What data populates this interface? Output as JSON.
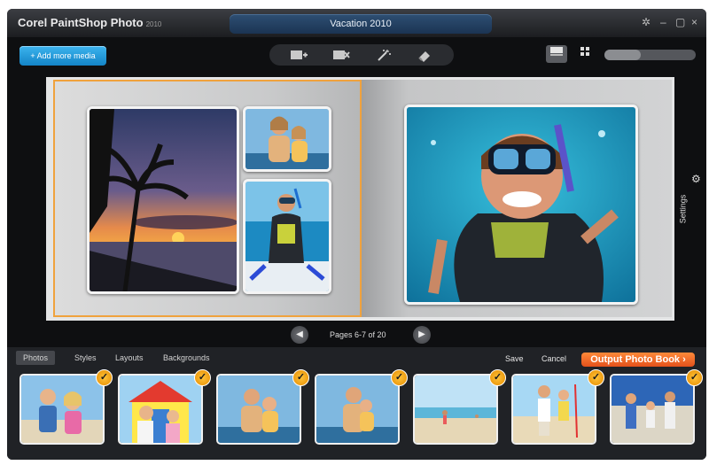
{
  "app": {
    "title": "Corel PaintShop Photo",
    "version": "2010",
    "document_title": "Vacation 2010"
  },
  "toolbar": {
    "add_media_label": "+ Add more media",
    "tools": [
      {
        "icon": "add-photo-icon"
      },
      {
        "icon": "remove-photo-icon"
      },
      {
        "icon": "magic-wand-icon"
      },
      {
        "icon": "eraser-icon"
      }
    ],
    "views": [
      {
        "icon": "single-view-icon",
        "active": true
      },
      {
        "icon": "grid-view-icon",
        "active": false
      }
    ],
    "zoom": 0.4
  },
  "window_controls": {
    "settings_symbol": "✲",
    "minimize_symbol": "–",
    "maximize_symbol": "▢",
    "close_symbol": "×"
  },
  "book": {
    "page_indicator": "Pages 6-7 of 20",
    "photos": [
      "palm-trees-sunset",
      "mother-daughter-beach",
      "woman-snorkel-boat",
      "woman-diver-closeup"
    ]
  },
  "settings_label": "Settings",
  "bottom": {
    "tabs": [
      {
        "label": "Photos",
        "active": true
      },
      {
        "label": "Styles",
        "active": false
      },
      {
        "label": "Layouts",
        "active": false
      },
      {
        "label": "Backgrounds",
        "active": false
      }
    ],
    "save_label": "Save",
    "cancel_label": "Cancel",
    "output_label": "Output Photo Book",
    "thumbnails": [
      {
        "subject": "two-kids-running"
      },
      {
        "subject": "kids-beach-hut"
      },
      {
        "subject": "mother-daughter-beach"
      },
      {
        "subject": "mother-daughter-beach-2"
      },
      {
        "subject": "person-on-beach"
      },
      {
        "subject": "couple-beach-pole"
      },
      {
        "subject": "family-beach-walk"
      }
    ],
    "check_symbol": "✓"
  },
  "colors": {
    "accent_orange": "#f0a23d",
    "blue_button": "#1384c7",
    "output_orange": "#e3511b",
    "check_gold": "#f3a51a"
  }
}
